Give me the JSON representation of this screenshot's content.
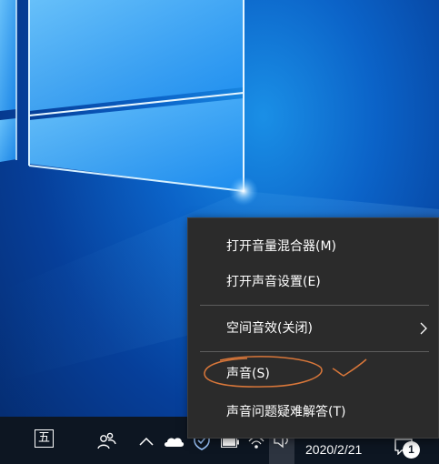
{
  "context_menu": {
    "items": [
      {
        "label": "打开音量混合器(M)"
      },
      {
        "label": "打开声音设置(E)"
      },
      {
        "label": "空间音效(关闭)",
        "has_submenu": true
      },
      {
        "label": "声音(S)",
        "annotated": true
      },
      {
        "label": "声音问题疑难解答(T)"
      }
    ]
  },
  "taskbar": {
    "ime_label": "五",
    "clock_date": "2020/2/21",
    "notification_count": "1",
    "icons": [
      "people-icon",
      "show-hidden-icons-chevron",
      "onedrive-cloud-icon",
      "windows-defender-shield-icon",
      "battery-icon",
      "network-icon",
      "volume-icon",
      "action-center-icon"
    ]
  },
  "colors": {
    "menu_bg": "#2b2b2b",
    "taskbar_bg": "#0d1622",
    "annotation": "#d9773a",
    "desktop_accent": "#0b63c8"
  }
}
